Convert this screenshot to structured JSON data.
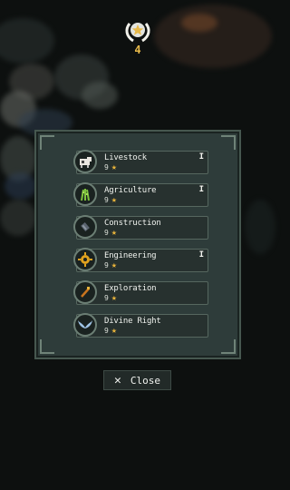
{
  "counter": {
    "value": "4"
  },
  "trees": [
    {
      "name": "Livestock",
      "level": "9",
      "tier": "I",
      "icon": "livestock-icon"
    },
    {
      "name": "Agriculture",
      "level": "9",
      "tier": "I",
      "icon": "agriculture-icon"
    },
    {
      "name": "Construction",
      "level": "9",
      "tier": "",
      "icon": "construction-icon"
    },
    {
      "name": "Engineering",
      "level": "9",
      "tier": "I",
      "icon": "engineering-icon"
    },
    {
      "name": "Exploration",
      "level": "9",
      "tier": "",
      "icon": "exploration-icon"
    },
    {
      "name": "Divine Right",
      "level": "9",
      "tier": "",
      "icon": "divine-right-icon"
    }
  ],
  "close": {
    "label": "Close"
  },
  "colors": {
    "star": "#e8b33b",
    "panel": "#2e3c3a",
    "accent": "#e7b94a"
  }
}
